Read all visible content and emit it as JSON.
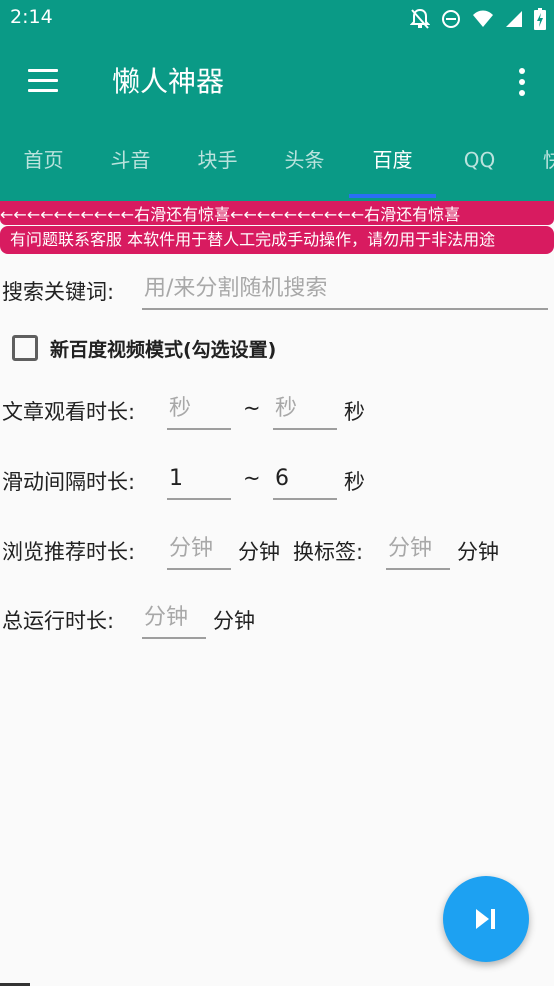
{
  "status_bar": {
    "time": "2:14"
  },
  "app": {
    "title": "懒人神器"
  },
  "tabs": [
    {
      "label": "首页"
    },
    {
      "label": "斗音"
    },
    {
      "label": "块手"
    },
    {
      "label": "头条"
    },
    {
      "label": "百度"
    },
    {
      "label": "QQ"
    },
    {
      "label": "快"
    }
  ],
  "active_tab": "百度",
  "marquee": {
    "text": "←←←←←←←←←←右滑还有惊喜←←←←←←←←←←右滑还有惊喜"
  },
  "notice": {
    "text": "有问题联系客服 本软件用于替人工完成手动操作，请勿用于非法用途"
  },
  "search": {
    "label": "搜索关键词:",
    "placeholder": "用/来分割随机搜索",
    "value": ""
  },
  "video_mode": {
    "label": "新百度视频模式(勾选设置)",
    "checked": false
  },
  "article_watch": {
    "label": "文章观看时长:",
    "min_placeholder": "秒",
    "min_value": "",
    "separator": "~",
    "max_placeholder": "秒",
    "max_value": "",
    "unit": "秒"
  },
  "scroll_interval": {
    "label": "滑动间隔时长:",
    "min_value": "1",
    "separator": "~",
    "max_value": "6",
    "unit": "秒"
  },
  "browse_recommend": {
    "label": "浏览推荐时长:",
    "placeholder": "分钟",
    "value": "",
    "unit": "分钟",
    "switch_tab_label": "换标签:",
    "switch_tab_placeholder": "分钟",
    "switch_tab_value": "",
    "switch_tab_unit": "分钟"
  },
  "total_run": {
    "label": "总运行时长:",
    "placeholder": "分钟",
    "value": "",
    "unit": "分钟"
  },
  "colors": {
    "primary": "#0a9a86",
    "accent": "#d81b60",
    "tab_indicator": "#2a6ff4",
    "fab": "#1da1f2"
  },
  "icons": {
    "status": [
      "notifications-off-icon",
      "do-not-disturb-icon",
      "wifi-icon",
      "signal-icon",
      "battery-charging-icon"
    ],
    "menu": "hamburger-menu-icon",
    "overflow": "more-vert-icon",
    "fab": "skip-next-icon"
  }
}
